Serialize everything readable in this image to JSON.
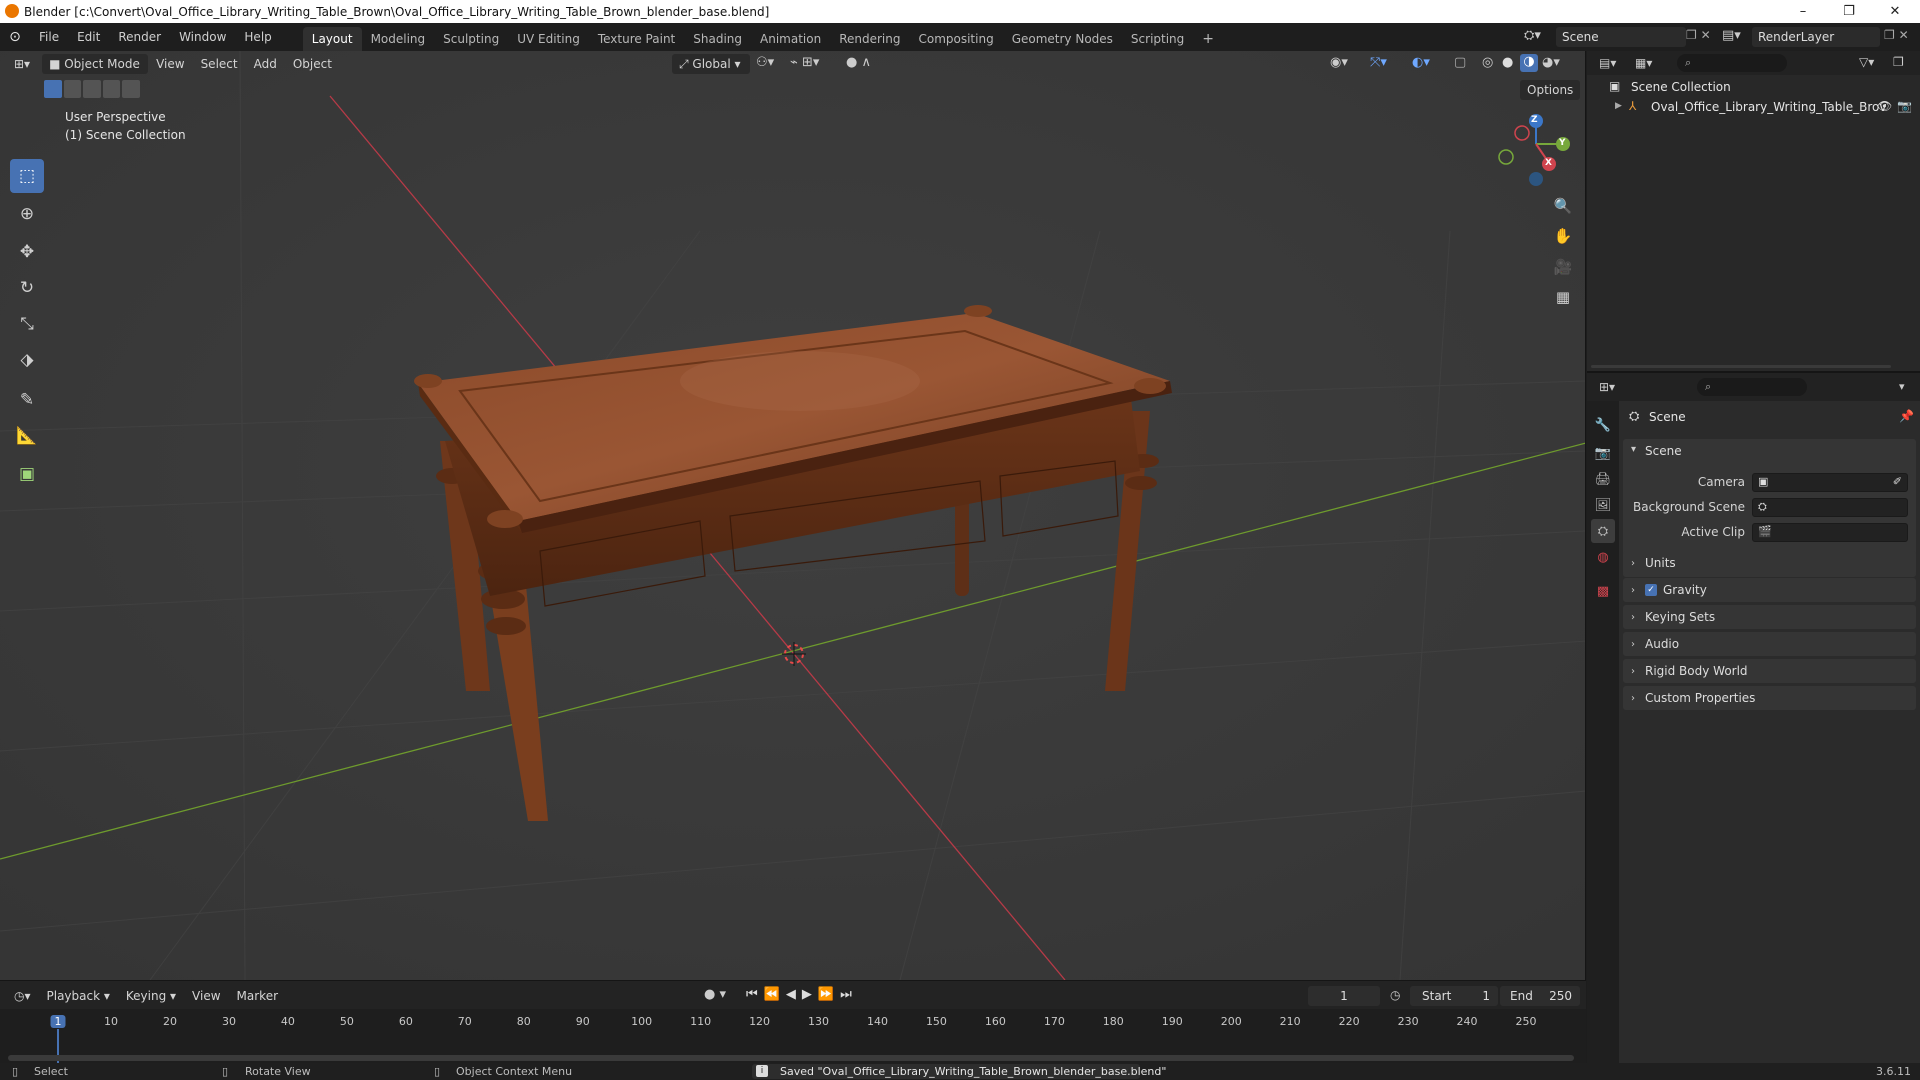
{
  "window": {
    "title": "Blender [c:\\Convert\\Oval_Office_Library_Writing_Table_Brown\\Oval_Office_Library_Writing_Table_Brown_blender_base.blend]",
    "minimize": "–",
    "maximize": "❐",
    "close": "✕"
  },
  "menu": {
    "items": [
      "File",
      "Edit",
      "Render",
      "Window",
      "Help"
    ]
  },
  "workspaces": {
    "tabs": [
      "Layout",
      "Modeling",
      "Sculpting",
      "UV Editing",
      "Texture Paint",
      "Shading",
      "Animation",
      "Rendering",
      "Compositing",
      "Geometry Nodes",
      "Scripting"
    ],
    "active": "Layout",
    "add": "+"
  },
  "topright": {
    "scene": "Scene",
    "render_layer": "RenderLayer"
  },
  "viewport": {
    "mode": "Object Mode",
    "menu": [
      "View",
      "Select",
      "Add",
      "Object"
    ],
    "orientation": "Global",
    "options": "Options",
    "overlay_line1": "User Perspective",
    "overlay_line2": "(1) Scene Collection",
    "gizmo": {
      "x": "X",
      "y": "Y",
      "z": "Z"
    }
  },
  "icons": {
    "tools": [
      "select-box-icon",
      "cursor-icon",
      "move-icon",
      "rotate-icon",
      "scale-icon",
      "transform-icon",
      "annotate-icon",
      "measure-icon",
      "add-cube-icon"
    ]
  },
  "timeline": {
    "menu": [
      "Playback",
      "Keying",
      "View",
      "Marker"
    ],
    "current_frame": "1",
    "start_label": "Start",
    "start": "1",
    "end_label": "End",
    "end": "250",
    "ruler": [
      {
        "v": 1,
        "t": "1"
      },
      {
        "v": 10,
        "t": "10"
      },
      {
        "v": 20,
        "t": "20"
      },
      {
        "v": 30,
        "t": "30"
      },
      {
        "v": 40,
        "t": "40"
      },
      {
        "v": 50,
        "t": "50"
      },
      {
        "v": 60,
        "t": "60"
      },
      {
        "v": 70,
        "t": "70"
      },
      {
        "v": 80,
        "t": "80"
      },
      {
        "v": 90,
        "t": "90"
      },
      {
        "v": 100,
        "t": "100"
      },
      {
        "v": 110,
        "t": "110"
      },
      {
        "v": 120,
        "t": "120"
      },
      {
        "v": 130,
        "t": "130"
      },
      {
        "v": 140,
        "t": "140"
      },
      {
        "v": 150,
        "t": "150"
      },
      {
        "v": 160,
        "t": "160"
      },
      {
        "v": 170,
        "t": "170"
      },
      {
        "v": 180,
        "t": "180"
      },
      {
        "v": 190,
        "t": "190"
      },
      {
        "v": 200,
        "t": "200"
      },
      {
        "v": 210,
        "t": "210"
      },
      {
        "v": 220,
        "t": "220"
      },
      {
        "v": 230,
        "t": "230"
      },
      {
        "v": 240,
        "t": "240"
      },
      {
        "v": 250,
        "t": "250"
      }
    ]
  },
  "outliner": {
    "root": "Scene Collection",
    "item": "Oval_Office_Library_Writing_Table_Brov"
  },
  "properties": {
    "header": "Scene",
    "section": "Scene",
    "camera_label": "Camera",
    "bg_label": "Background Scene",
    "clip_label": "Active Clip",
    "panels": [
      "Units",
      "Gravity",
      "Keying Sets",
      "Audio",
      "Rigid Body World",
      "Custom Properties"
    ]
  },
  "status": {
    "select": "Select",
    "rotate": "Rotate View",
    "context": "Object Context Menu",
    "message": "Saved \"Oval_Office_Library_Writing_Table_Brown_blender_base.blend\"",
    "version": "3.6.11"
  }
}
